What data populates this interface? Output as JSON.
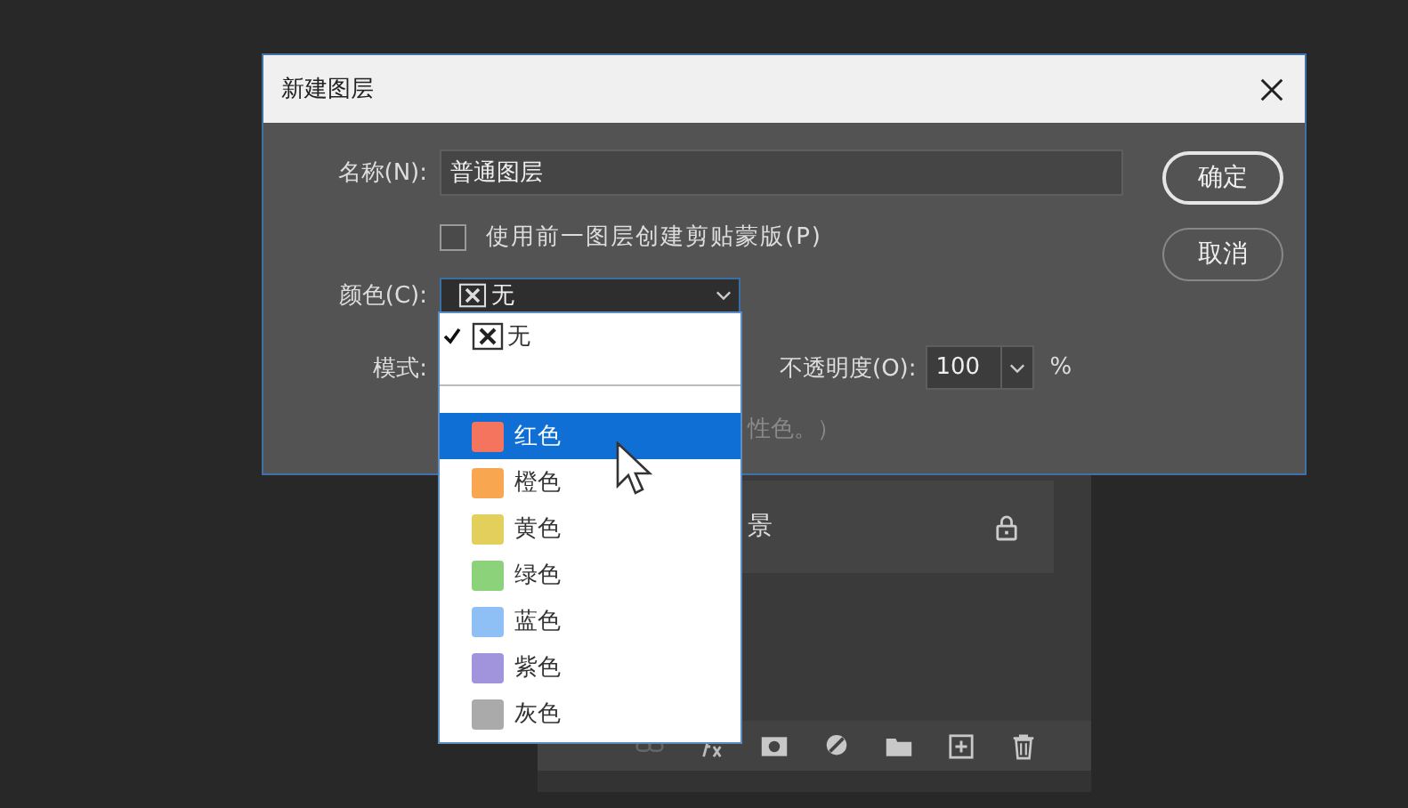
{
  "layers_panel": {
    "layer_name": "景",
    "locked": true
  },
  "dialog": {
    "title": "新建图层",
    "name_label": "名称(N):",
    "name_value": "普通图层",
    "clip_checkbox": {
      "label": "使用前一图层创建剪贴蒙版(P)",
      "checked": false
    },
    "color_label": "颜色(C):",
    "color_value": "无",
    "mode_label": "模式:",
    "opacity_label": "不透明度(O):",
    "opacity_value": "100",
    "opacity_unit": "%",
    "hint": "性色。）",
    "buttons": [
      {
        "label": "确定",
        "default": true
      },
      {
        "label": "取消",
        "default": false
      }
    ]
  },
  "color_menu": [
    {
      "kind": "none",
      "label": "无",
      "checked": true,
      "selected": false
    },
    {
      "kind": "separator"
    },
    {
      "kind": "swatch",
      "label": "红色",
      "color": "#f4745e",
      "checked": false,
      "selected": true
    },
    {
      "kind": "swatch",
      "label": "橙色",
      "color": "#f8a650",
      "checked": false,
      "selected": false
    },
    {
      "kind": "swatch",
      "label": "黄色",
      "color": "#e3d05c",
      "checked": false,
      "selected": false
    },
    {
      "kind": "swatch",
      "label": "绿色",
      "color": "#8cd27a",
      "checked": false,
      "selected": false
    },
    {
      "kind": "swatch",
      "label": "蓝色",
      "color": "#8ec0f5",
      "checked": false,
      "selected": false
    },
    {
      "kind": "swatch",
      "label": "紫色",
      "color": "#a193dc",
      "checked": false,
      "selected": false
    },
    {
      "kind": "swatch",
      "label": "灰色",
      "color": "#aaaaaa",
      "checked": false,
      "selected": false
    }
  ]
}
